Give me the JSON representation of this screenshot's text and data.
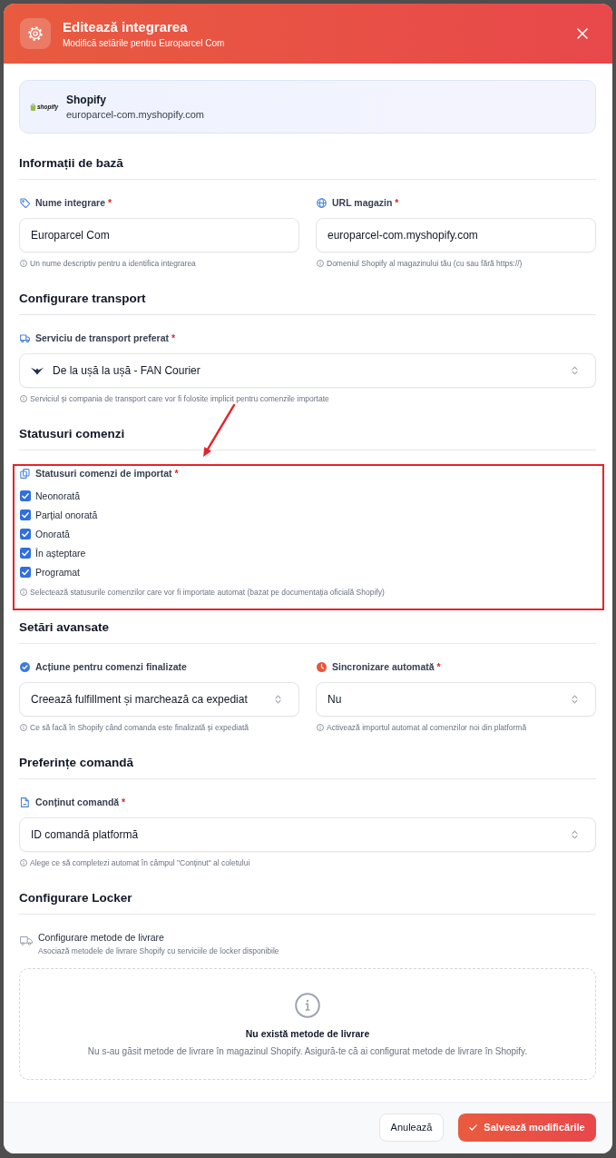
{
  "header": {
    "title": "Editează integrarea",
    "subtitle": "Modifică setările pentru Europarcel Com"
  },
  "platform": {
    "logo_text": "shopify",
    "name": "Shopify",
    "url": "europarcel-com.myshopify.com"
  },
  "sections": [
    {
      "title": "Informații de bază",
      "rows": [
        [
          {
            "kind": "text",
            "label": "Nume integrare",
            "required_mark": "*",
            "value": "Europarcel Com",
            "hint": "Un nume descriptiv pentru a identifica integrarea"
          },
          {
            "kind": "text",
            "label": "URL magazin",
            "required_mark": "*",
            "value": "europarcel-com.myshopify.com",
            "hint": "Domeniul Shopify al magazinului tău (cu sau fără https://)"
          }
        ]
      ]
    },
    {
      "title": "Configurare transport",
      "rows": [
        [
          {
            "kind": "select",
            "label": "Serviciu de transport preferat",
            "required_mark": "*",
            "value": "De la ușă la ușă - FAN Courier",
            "has_logo": true,
            "hint": "Serviciul și compania de transport care vor fi folosite implicit pentru comenzile importate"
          }
        ]
      ]
    },
    {
      "title": "Statusuri comenzi",
      "rows": [
        [
          {
            "kind": "checkboxes",
            "label": "Statusuri comenzi de importat",
            "required_mark": "*",
            "highlighted": true,
            "options": [
              {
                "label": "Neonorată",
                "checked": true
              },
              {
                "label": "Parțial onorată",
                "checked": true
              },
              {
                "label": "Onorată",
                "checked": true
              },
              {
                "label": "În așteptare",
                "checked": true
              },
              {
                "label": "Programat",
                "checked": true
              }
            ],
            "hint": "Selectează statusurile comenzilor care vor fi importate automat (bazat pe documentația oficială Shopify)"
          }
        ]
      ]
    },
    {
      "title": "Setări avansate",
      "rows": [
        [
          {
            "kind": "select",
            "label": "Acțiune pentru comenzi finalizate",
            "value": "Creează fulfillment și marchează ca expediat",
            "hint": "Ce să facă în Shopify când comanda este finalizată și expediată"
          },
          {
            "kind": "select",
            "label": "Sincronizare automată",
            "required_mark": "*",
            "value": "Nu",
            "hint": "Activează importul automat al comenzilor noi din platformă"
          }
        ]
      ]
    },
    {
      "title": "Preferințe comandă",
      "rows": [
        [
          {
            "kind": "select",
            "label": "Conținut comandă",
            "required_mark": "*",
            "value": "ID comandă platformă",
            "hint": "Alege ce să completezi automat în câmpul \"Conținut\" al coletului"
          }
        ]
      ]
    },
    {
      "title": "Configurare Locker",
      "rows": [
        [
          {
            "kind": "locker",
            "label": "Configurare metode de livrare",
            "description": "Asociază metodele de livrare Shopify cu serviciile de locker disponibile",
            "empty_title": "Nu există metode de livrare",
            "empty_text": "Nu s-au găsit metode de livrare în magazinul Shopify. Asigură-te că ai configurat metode de livrare în Shopify."
          }
        ]
      ]
    }
  ],
  "footer": {
    "buttons": [
      {
        "kind": "secondary",
        "label": "Anulează"
      },
      {
        "kind": "primary",
        "label": "Salvează modificările"
      }
    ]
  }
}
